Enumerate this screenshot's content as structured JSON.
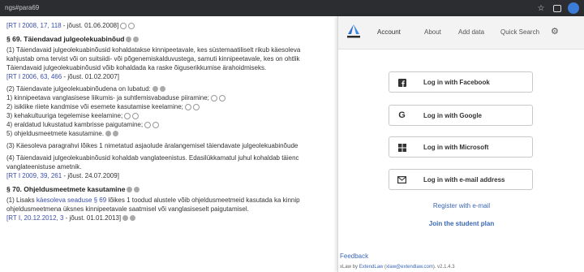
{
  "browser": {
    "url": "ngs#para69"
  },
  "document": {
    "ref1": {
      "ref": "[RT I 2008, 17, 118",
      "rest": " - jõust. 01.06.2008]"
    },
    "s69": {
      "heading": "§ 69.  Täiendavad julgeolekuabinõud",
      "p1": [
        "(1) Täiendavaid julgeolekuabinõusid kohaldatakse kinnipeetavale, kes süstemaatiliselt rikub käesoleva",
        "kahjustab oma tervist või on suitsiidi- või põgenemiskalduvustega, samuti kinnipeetavale, kes on ohtlik",
        "Täiendavaid julgeolekuabinõusid võib kohaldada ka raske õiguserikkumise ärahoidmiseks."
      ],
      "p1_ref": {
        "ref": "[RT I 2006, 63, 466",
        "rest": " - jõust. 01.02.2007]"
      },
      "p2": "(2) Täiendavate julgeolekuabinõudena on lubatud:",
      "items": [
        "1) kinnipeetava vanglasisese liikumis- ja suhtlemisvabaduse piiramine;",
        "2) isiklike riiete kandmise või esemete kasutamise keelamine;",
        "3) kehakultuuriga tegelemise keelamine;",
        "4) eraldatud lukustatud kambrisse paigutamine;",
        "5) ohjeldusmeetmete kasutamine."
      ],
      "p3": "(3) Käesoleva paragrahvi lõikes 1 nimetatud asjaolude äralangemisel täiendavate julgeolekuabinõude",
      "p4": [
        "(4) Täiendavaid julgeolekuabinõusid kohaldab vanglateenistus. Edasilükkamatul juhul kohaldab täienc",
        "vanglateenistuse ametnik."
      ],
      "p4_ref": {
        "ref": "[RT I 2009, 39, 261",
        "rest": " - jõust. 24.07.2009]"
      }
    },
    "s70": {
      "heading": "§ 70.  Ohjeldusmeetmete kasutamine",
      "p1_pre": "(1) Lisaks ",
      "p1_link": "käesoleva seaduse § 69",
      "p1_post": " lõikes 1 toodud alustele võib ohjeldusmeetmeid kasutada ka kinnip",
      "p1_l2": "ohjeldusmeetmena üksnes kinnipeetavale saatmisel või vanglasiseselt paigutamisel.",
      "p1_ref": {
        "ref": "[RT I, 20.12.2012, 3",
        "rest": " - jõust. 01.01.2013]"
      }
    }
  },
  "panel": {
    "tabs": [
      "Account",
      "About",
      "Add data",
      "Quick Search"
    ],
    "buttons": [
      {
        "label": "Log in with Facebook",
        "icon": "facebook-icon"
      },
      {
        "label": "Log in with Google",
        "icon": "google-icon"
      },
      {
        "label": "Log in with Microsoft",
        "icon": "microsoft-icon"
      },
      {
        "label": "Log in with e-mail address",
        "icon": "envelope-icon"
      }
    ],
    "register": "Register with e-mail",
    "student": "Join the student plan",
    "feedback": "Feedback",
    "footer": {
      "pre": "xLaw by ",
      "company": "ExtendLaw",
      "mid": " (",
      "email": "xlaw@extendlaw.com",
      "post": "). v2.1.4.3"
    },
    "accent_color": "#3a67b5"
  }
}
